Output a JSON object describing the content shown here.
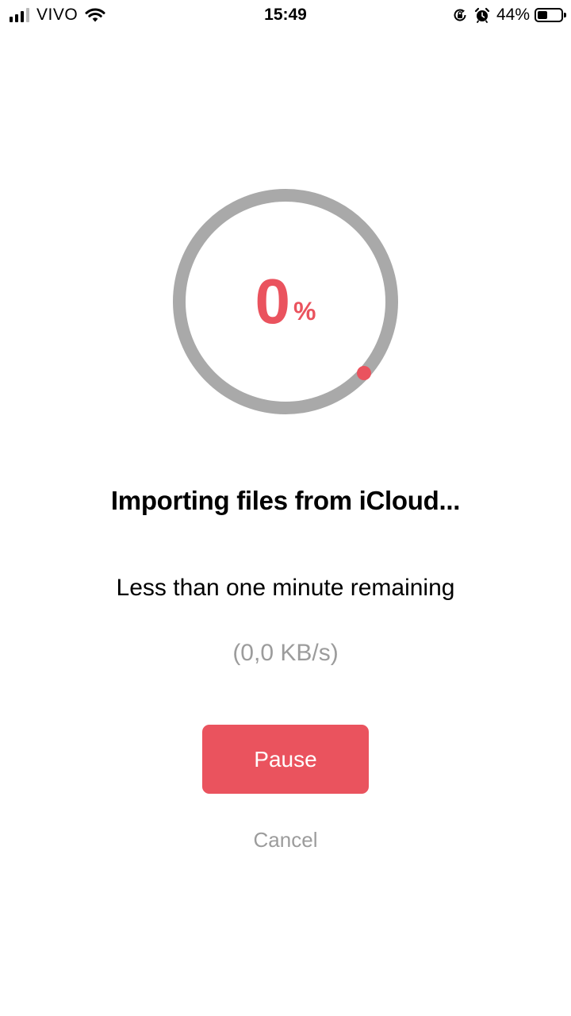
{
  "status_bar": {
    "carrier": "VIVO",
    "time": "15:49",
    "battery_percent": "44%",
    "battery_level": 0.44,
    "signal_bars_active": 3,
    "signal_bars_total": 4,
    "icons": [
      "signal-icon",
      "wifi-icon",
      "lock-rotation-icon",
      "alarm-icon",
      "battery-icon"
    ]
  },
  "progress": {
    "value": "0",
    "sign": "%",
    "fraction": 0.0,
    "ring_color": "#a9a9a9",
    "accent_color": "#ea535e"
  },
  "main": {
    "title": "Importing files from iCloud...",
    "subtitle": "Less than one minute remaining",
    "speed": "(0,0 KB/s)"
  },
  "actions": {
    "pause_label": "Pause",
    "cancel_label": "Cancel"
  }
}
